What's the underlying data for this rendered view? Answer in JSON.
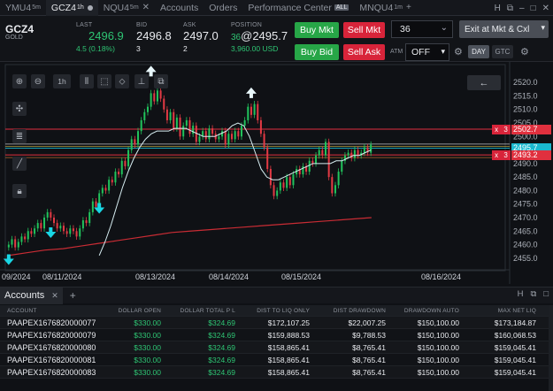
{
  "tabs": [
    {
      "label": "YMU4",
      "sup": "5m",
      "active": false
    },
    {
      "label": "GCZ4",
      "sup": "1h",
      "active": true
    },
    {
      "label": "NQU4",
      "sup": "5m",
      "active": false
    },
    {
      "label": "Accounts",
      "sup": "",
      "active": false
    },
    {
      "label": "Orders",
      "sup": "",
      "active": false
    },
    {
      "label": "Performance Center",
      "sup": "",
      "badge": "ALL",
      "active": false
    },
    {
      "label": "MNQU4",
      "sup": "1m",
      "active": false
    }
  ],
  "window_controls": {
    "help": "H",
    "popout": "⧉",
    "min": "–",
    "max": "□",
    "close": "✕"
  },
  "quote": {
    "symbol": "GCZ4",
    "symbol_desc": "GOLD",
    "last_label": "LAST",
    "last": "2496.9",
    "change": "4.5 (0.18%)",
    "bid_label": "BID",
    "bid": "2496.8",
    "bid_size": "3",
    "ask_label": "ASK",
    "ask": "2497.0",
    "ask_size": "2",
    "position_label": "POSITION",
    "position_qty": "36",
    "position_price": "@2495.7",
    "position_pl": "3,960.00 USD",
    "buy_mkt": "Buy Mkt",
    "sell_mkt": "Sell Mkt",
    "buy_bid": "Buy Bid",
    "sell_ask": "Sell Ask",
    "quantity": "36",
    "exit_label": "Exit at Mkt & Cxl",
    "atm_label": "ATM",
    "atm_value": "OFF",
    "tif_day": "DAY",
    "tif_gtc": "GTC"
  },
  "chart_toolbar": {
    "interval": "1h",
    "back_arrow": "←"
  },
  "chart_data": {
    "type": "candlestick",
    "symbol": "GCZ4",
    "interval": "1h",
    "ylim": [
      2452,
      2523
    ],
    "y_ticks": [
      2520.0,
      2515.0,
      2510.0,
      2505.0,
      2500.0,
      2495.0,
      2490.0,
      2485.0,
      2480.0,
      2475.0,
      2470.0,
      2465.0,
      2460.0,
      2455.0
    ],
    "y_tick_labels": [
      "2520.0",
      "2515.0",
      "2510.0",
      "2505.0",
      "2500.0",
      "2495.0",
      "2490.0",
      "2485.0",
      "2480.0",
      "2475.0",
      "2470.0",
      "2465.0",
      "2460.0",
      "2455.0"
    ],
    "x_tick_labels": [
      "09/2024",
      "08/11/2024",
      "08/13/2024",
      "08/14/2024",
      "08/15/2024",
      "08/16/2024"
    ],
    "closes": [
      2460,
      2462,
      2459,
      2461,
      2463,
      2462,
      2465,
      2464,
      2466,
      2468,
      2466,
      2470,
      2472,
      2470,
      2468,
      2466,
      2467,
      2465,
      2464,
      2466,
      2465,
      2463,
      2466,
      2469,
      2468,
      2472,
      2476,
      2474,
      2479,
      2481,
      2480,
      2484,
      2483,
      2487,
      2486,
      2491,
      2489,
      2495,
      2499,
      2497,
      2502,
      2506,
      2509,
      2511,
      2516,
      2513,
      2517,
      2514,
      2510,
      2506,
      2509,
      2503,
      2507,
      2500,
      2504,
      2506,
      2501,
      2504,
      2498,
      2500,
      2502,
      2499,
      2503,
      2501,
      2499,
      2500,
      2502,
      2497,
      2501,
      2499,
      2502,
      2500,
      2504,
      2506,
      2511,
      2508,
      2512,
      2506,
      2501,
      2496,
      2488,
      2482,
      2478,
      2480,
      2483,
      2481,
      2485,
      2482,
      2486,
      2488,
      2486,
      2489,
      2487,
      2491,
      2490,
      2493,
      2495,
      2493,
      2498,
      2485,
      2479,
      2482,
      2487,
      2491,
      2493,
      2494,
      2492,
      2495,
      2493,
      2494,
      2496,
      2494,
      2497
    ],
    "ma_fast": {
      "start": 28,
      "values": [
        2456,
        2461,
        2467,
        2474,
        2481,
        2487,
        2492,
        2496,
        2499,
        2501,
        2502,
        2502,
        2502,
        2503,
        2503,
        2503,
        2502,
        2501,
        2500,
        2500,
        2500,
        2501,
        2502,
        2504,
        2505,
        2504,
        2500,
        2494,
        2488,
        2485,
        2484,
        2484,
        2485,
        2486,
        2487,
        2488,
        2489,
        2490,
        2490,
        2490,
        2490,
        2491,
        2491,
        2492,
        2493,
        2493,
        2494,
        2495
      ]
    },
    "ma_slow": {
      "values": [
        2456,
        2457,
        2458,
        2458.5,
        2459.5,
        2460.5,
        2461.5,
        2462.5,
        2463.5,
        2464.5,
        2465,
        2465.5,
        2466,
        2466.5,
        2467,
        2467.5,
        2468,
        2468.5,
        2469,
        2469.5,
        2470
      ]
    },
    "markers": [
      {
        "index": 0,
        "type": "buy"
      },
      {
        "index": 13,
        "type": "buy"
      },
      {
        "index": 28,
        "type": "buy"
      },
      {
        "index": 44,
        "type": "sell"
      },
      {
        "index": 75,
        "type": "sell"
      }
    ],
    "levels": [
      {
        "price": 2502.7,
        "label": "2502.7",
        "qty": "3",
        "kind": "stop-high"
      },
      {
        "price": 2495.7,
        "label": "2495.7",
        "kind": "position"
      },
      {
        "price": 2493.2,
        "label": "2493.2",
        "qty": "3",
        "kind": "stop-low"
      },
      {
        "price": 2497.2,
        "label": "",
        "kind": "ref-white"
      },
      {
        "price": 2496.3,
        "label": "",
        "kind": "ref-yellow"
      },
      {
        "price": 2492.2,
        "label": "",
        "kind": "ref-orange"
      }
    ],
    "colors": {
      "up": "#21c35c",
      "down": "#e33a44",
      "ma_fast": "#d7eef2",
      "ma_slow": "#c92c34",
      "marker_buy": "#19d6e4",
      "level_red": "#e0303e",
      "level_position": "#1ab8cf"
    }
  },
  "accounts": {
    "tab_label": "Accounts",
    "columns": [
      "ACCOUNT",
      "DOLLAR OPEN",
      "DOLLAR TOTAL P L",
      "DIST TO LIQ ONLY",
      "DIST DRAWDOWN",
      "DRAWDOWN AUTO",
      "MAX NET LIQ"
    ],
    "rows": [
      [
        "PAAPEX1676820000077",
        "$330.00",
        "$324.69",
        "$172,107.25",
        "$22,007.25",
        "$150,100.00",
        "$173,184.87"
      ],
      [
        "PAAPEX1676820000079",
        "$330.00",
        "$324.69",
        "$159,888.53",
        "$9,788.53",
        "$150,100.00",
        "$160,068.53"
      ],
      [
        "PAAPEX1676820000080",
        "$330.00",
        "$324.69",
        "$158,865.41",
        "$8,765.41",
        "$150,100.00",
        "$159,045.41"
      ],
      [
        "PAAPEX1676820000081",
        "$330.00",
        "$324.69",
        "$158,865.41",
        "$8,765.41",
        "$150,100.00",
        "$159,045.41"
      ],
      [
        "PAAPEX1676820000083",
        "$330.00",
        "$324.69",
        "$158,865.41",
        "$8,765.41",
        "$150,100.00",
        "$159,045.41"
      ]
    ]
  }
}
